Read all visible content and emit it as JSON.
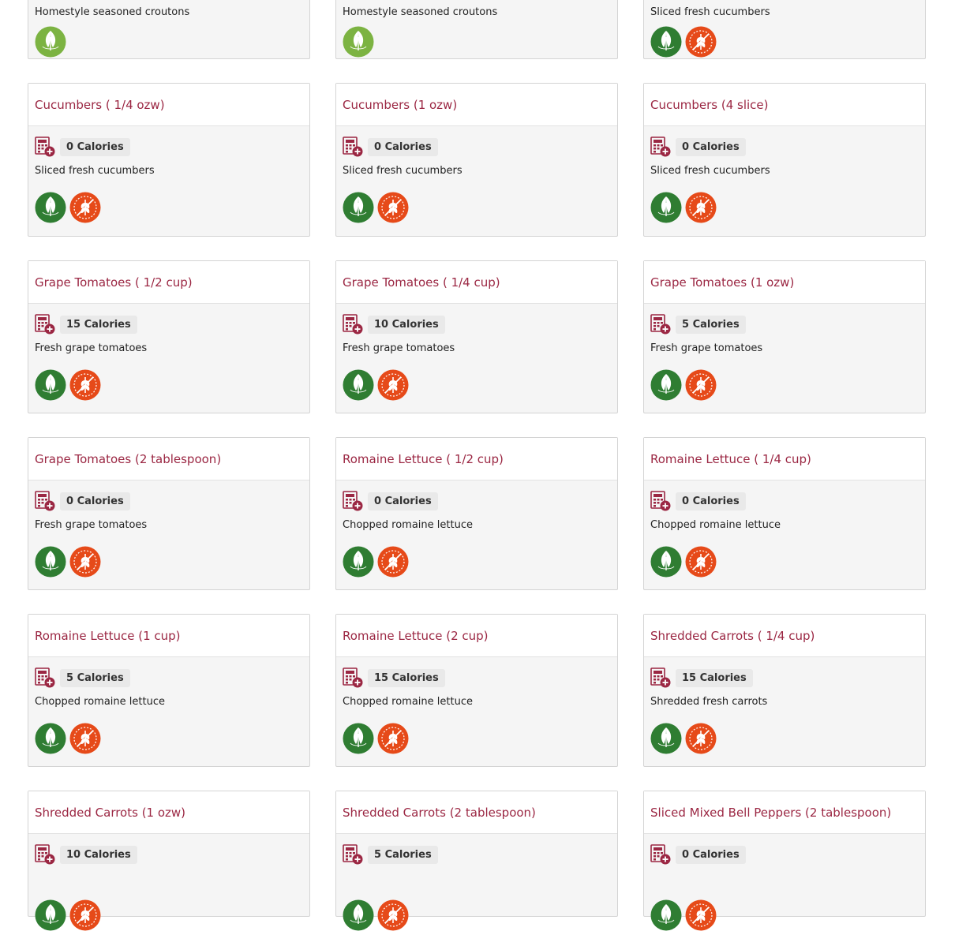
{
  "colors": {
    "title": "#9b2743",
    "vegan_badge": "#2f7d32",
    "vegetarian_badge": "#7cb342",
    "gluten_badge": "#e64a19"
  },
  "icons": {
    "nutrition": "calculator-plus-icon",
    "vegan": "vegan-leaf-icon",
    "vegetarian": "vegetarian-leaf-icon",
    "gluten": "gluten-free-icon"
  },
  "row0": [
    {
      "desc": "Homestyle seasoned croutons"
    },
    {
      "desc": "Homestyle seasoned croutons"
    },
    {
      "desc": "Sliced fresh cucumbers"
    }
  ],
  "items": [
    {
      "title": "Cucumbers ( 1/4 ozw)",
      "calories": "0 Calories",
      "desc": "Sliced fresh cucumbers"
    },
    {
      "title": "Cucumbers (1 ozw)",
      "calories": "0 Calories",
      "desc": "Sliced fresh cucumbers"
    },
    {
      "title": "Cucumbers (4 slice)",
      "calories": "0 Calories",
      "desc": "Sliced fresh cucumbers"
    },
    {
      "title": "Grape Tomatoes ( 1/2 cup)",
      "calories": "15 Calories",
      "desc": "Fresh grape tomatoes"
    },
    {
      "title": "Grape Tomatoes ( 1/4 cup)",
      "calories": "10 Calories",
      "desc": "Fresh grape tomatoes"
    },
    {
      "title": "Grape Tomatoes (1 ozw)",
      "calories": "5 Calories",
      "desc": "Fresh grape tomatoes"
    },
    {
      "title": "Grape Tomatoes (2 tablespoon)",
      "calories": "0 Calories",
      "desc": "Fresh grape tomatoes"
    },
    {
      "title": "Romaine Lettuce ( 1/2 cup)",
      "calories": "0 Calories",
      "desc": "Chopped romaine lettuce"
    },
    {
      "title": "Romaine Lettuce ( 1/4 cup)",
      "calories": "0 Calories",
      "desc": "Chopped romaine lettuce"
    },
    {
      "title": "Romaine Lettuce (1 cup)",
      "calories": "5 Calories",
      "desc": "Chopped romaine lettuce"
    },
    {
      "title": "Romaine Lettuce (2 cup)",
      "calories": "15 Calories",
      "desc": "Chopped romaine lettuce"
    },
    {
      "title": "Shredded Carrots ( 1/4 cup)",
      "calories": "15 Calories",
      "desc": "Shredded fresh carrots"
    },
    {
      "title": "Shredded Carrots (1 ozw)",
      "calories": "10 Calories",
      "desc": ""
    },
    {
      "title": "Shredded Carrots (2 tablespoon)",
      "calories": "5 Calories",
      "desc": ""
    },
    {
      "title": "Sliced Mixed Bell Peppers (2 tablespoon)",
      "calories": "0 Calories",
      "desc": ""
    }
  ]
}
